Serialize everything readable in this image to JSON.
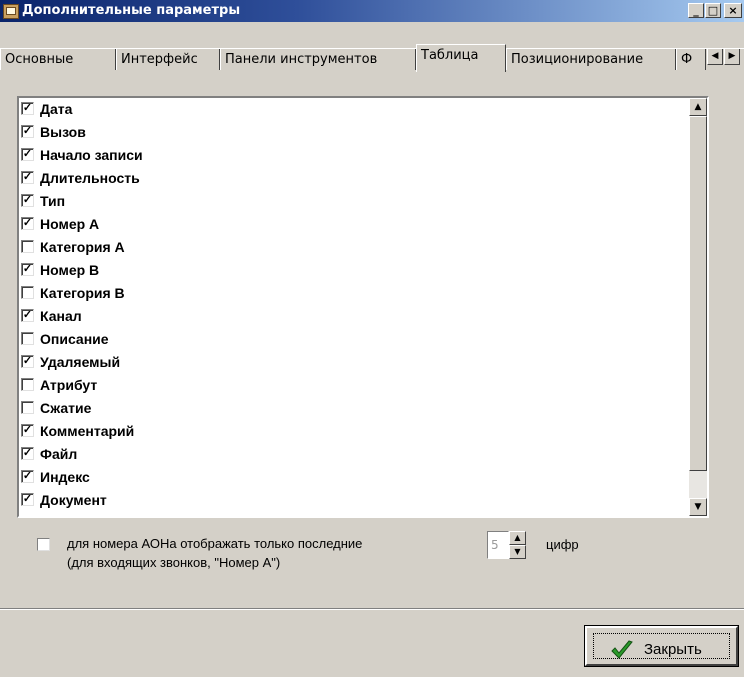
{
  "window": {
    "title": "Дополнительные параметры",
    "minimize_glyph": "_",
    "maximize_glyph": "□",
    "close_glyph": "×"
  },
  "tabs": [
    {
      "label": "Основные",
      "active": false
    },
    {
      "label": "Интерфейс",
      "active": false
    },
    {
      "label": "Панели инструментов",
      "active": false
    },
    {
      "label": "Таблица",
      "active": true
    },
    {
      "label": "Позиционирование",
      "active": false
    },
    {
      "label": "Ф",
      "active": false
    }
  ],
  "tab_scroll": {
    "left_glyph": "◀",
    "right_glyph": "▶"
  },
  "columns_list": {
    "check_glyph": "✓",
    "items": [
      {
        "label": "Дата",
        "checked": true
      },
      {
        "label": "Вызов",
        "checked": true
      },
      {
        "label": "Начало записи",
        "checked": true
      },
      {
        "label": "Длительность",
        "checked": true
      },
      {
        "label": "Тип",
        "checked": true
      },
      {
        "label": "Номер А",
        "checked": true
      },
      {
        "label": "Категория А",
        "checked": false
      },
      {
        "label": "Номер В",
        "checked": true
      },
      {
        "label": "Категория В",
        "checked": false
      },
      {
        "label": "Канал",
        "checked": true
      },
      {
        "label": "Описание",
        "checked": false
      },
      {
        "label": "Удаляемый",
        "checked": true
      },
      {
        "label": "Атрибут",
        "checked": false
      },
      {
        "label": "Сжатие",
        "checked": false
      },
      {
        "label": "Комментарий",
        "checked": true
      },
      {
        "label": "Файл",
        "checked": true
      },
      {
        "label": "Индекс",
        "checked": true
      },
      {
        "label": "Документ",
        "checked": true
      }
    ]
  },
  "scrollbar": {
    "up_glyph": "▲",
    "down_glyph": "▼"
  },
  "aon_option": {
    "checked": false,
    "label": "для номера АОНа отображать только  последние",
    "hint": "(для входящих звонков, \"Номер А\")",
    "digits_value": "5",
    "unit_label": "цифр"
  },
  "spin_glyphs": {
    "up": "▲",
    "down": "▼"
  },
  "close_button": {
    "label": "Закрыть"
  },
  "colors": {
    "title_gradient_start": "#0a246a",
    "title_gradient_end": "#a6caf0",
    "face": "#d4d0c8",
    "check_green": "#2a9a2a"
  }
}
